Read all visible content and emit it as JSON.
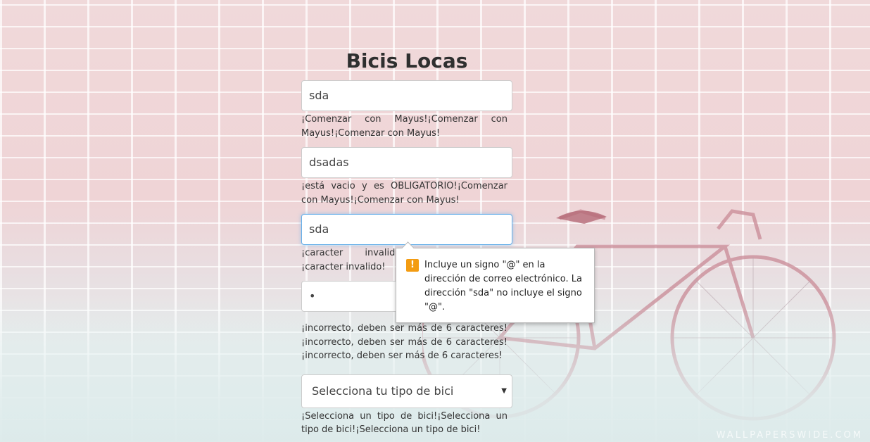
{
  "page": {
    "title": "Bicis Locas",
    "watermark": "WALLPAPERSWIDE.COM"
  },
  "form": {
    "name": {
      "value": "sda",
      "error": "¡Comenzar con Mayus!¡Comenzar con Mayus!¡Comenzar con Mayus!"
    },
    "lastname": {
      "value": "dsadas",
      "error": "¡está vacio y es OBLIGATORIO!¡Comenzar con Mayus!¡Comenzar con Mayus!"
    },
    "email": {
      "value": "sda",
      "error": "¡caracter invalido!¡caracter invalido!¡caracter invalido!"
    },
    "password": {
      "value": "•",
      "error": " ¡incorrecto, deben ser más de 6 caracteres!¡incorrecto, deben ser más de 6 caracteres!¡incorrecto, deben ser más de 6 caracteres!"
    },
    "bike_type": {
      "selected": "Selecciona tu tipo de bici",
      "error": "¡Selecciona un tipo de bici!¡Selecciona un tipo de bici!¡Selecciona un tipo de bici!"
    }
  },
  "validation_tooltip": {
    "icon": "warning-icon",
    "text": "Incluye un signo \"@\" en la dirección de correo electrónico. La dirección \"sda\" no incluye el signo \"@\"."
  },
  "colors": {
    "focus_border": "#66afe9",
    "warning": "#f39c12",
    "bike_frame": "#c98a96"
  }
}
